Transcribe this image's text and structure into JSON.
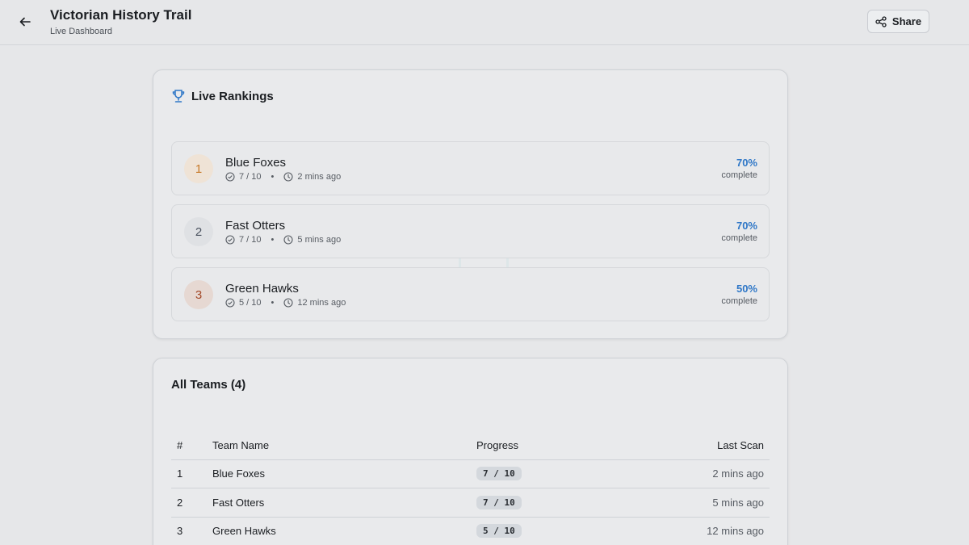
{
  "header": {
    "title": "Victorian History Trail",
    "subtitle": "Live Dashboard",
    "share_label": "Share"
  },
  "rankings": {
    "title": "Live Rankings",
    "items": [
      {
        "rank": "1",
        "name": "Blue Foxes",
        "progress": "7 / 10",
        "time": "2 mins ago",
        "percent": "70%",
        "percent_label": "complete",
        "badge_bg": "#efe3d6",
        "badge_fg": "#c77a2a"
      },
      {
        "rank": "2",
        "name": "Fast Otters",
        "progress": "7 / 10",
        "time": "5 mins ago",
        "percent": "70%",
        "percent_label": "complete",
        "badge_bg": "#dfe1e4",
        "badge_fg": "#4b5360"
      },
      {
        "rank": "3",
        "name": "Green Hawks",
        "progress": "5 / 10",
        "time": "12 mins ago",
        "percent": "50%",
        "percent_label": "complete",
        "badge_bg": "#e6d8d2",
        "badge_fg": "#a44a2a"
      }
    ]
  },
  "teams": {
    "title": "All Teams (4)",
    "columns": [
      "#",
      "Team Name",
      "Progress",
      "Last Scan"
    ],
    "rows": [
      {
        "num": "1",
        "name": "Blue Foxes",
        "progress": "7 / 10",
        "last": "2 mins ago"
      },
      {
        "num": "2",
        "name": "Fast Otters",
        "progress": "7 / 10",
        "last": "5 mins ago"
      },
      {
        "num": "3",
        "name": "Green Hawks",
        "progress": "5 / 10",
        "last": "12 mins ago"
      }
    ]
  },
  "colors": {
    "accent": "#2f77c7",
    "trophy": "#2f77c7"
  }
}
